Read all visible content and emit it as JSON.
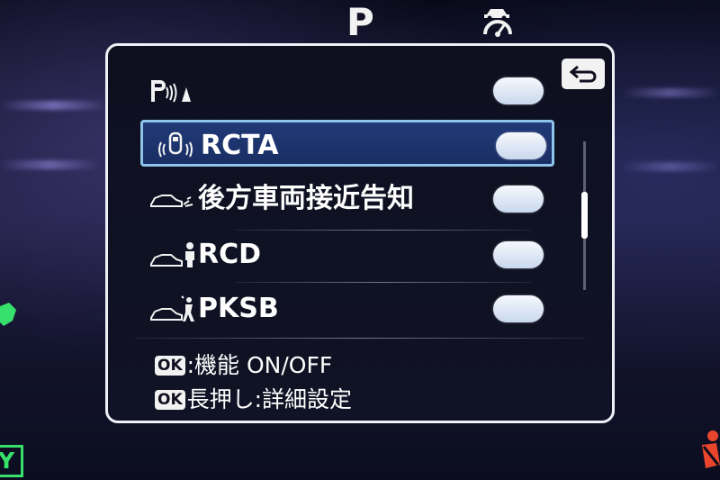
{
  "header": {
    "gear": "P",
    "icon": "vehicle-assist-gauge-icon"
  },
  "panel": {
    "back_icon": "return-arrow-icon",
    "rows": [
      {
        "icon": "parking-sonar-icon",
        "label": "",
        "selected": false
      },
      {
        "icon": "rcta-car-sensor-icon",
        "label": "RCTA",
        "selected": true
      },
      {
        "icon": "car-approach-alert-icon",
        "label": "後方車両接近告知",
        "selected": false
      },
      {
        "icon": "car-pedestrian-icon",
        "label": "RCD",
        "selected": false
      },
      {
        "icon": "car-brake-pksb-icon",
        "label": "PKSB",
        "selected": false
      }
    ],
    "hints": [
      {
        "badge": "OK",
        "text": ":機能 ON/OFF"
      },
      {
        "badge": "OK",
        "text": "長押し:詳細設定"
      }
    ]
  },
  "edge": {
    "bottom_left_text": "Y",
    "accent_green": "#37e06a",
    "accent_red": "#e8452c"
  }
}
